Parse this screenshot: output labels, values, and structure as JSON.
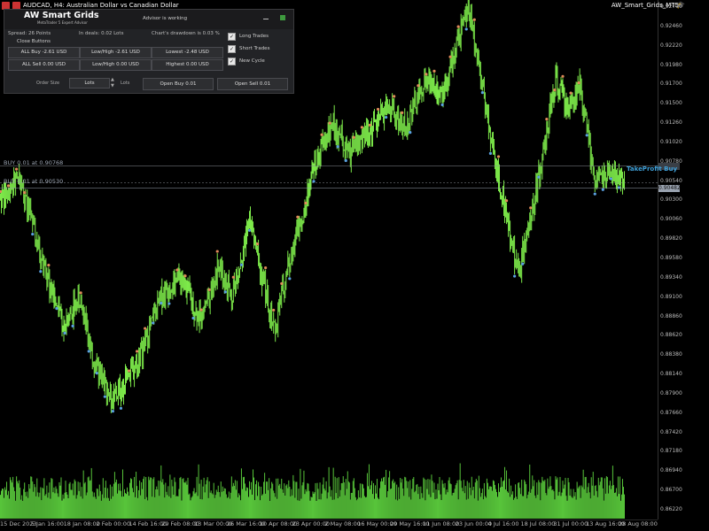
{
  "window": {
    "symbol_title": "AUDCAD, H4:  Australian Dollar vs Canadian Dollar",
    "indicator_name": "AW_Smart_Grids_MT5"
  },
  "colors": {
    "background": "#000000",
    "price_bars": "#7dea4a",
    "volume": "#57c43a",
    "buy_marker": "#5aa0e0",
    "sell_marker": "#e08a5a",
    "take_profit": "#3fa0d8"
  },
  "icons": {
    "window_icon": "chart-window-icon",
    "indicator_icon": "graduation-cap-icon"
  },
  "panel": {
    "title": "AW Smart Grids",
    "subtitle": "MetaTrader 5 Expert Advisor",
    "status": "Advisor is working",
    "stats": {
      "spread": "Spread: 26 Points",
      "in_deals": "In deals: 0.02 Lots",
      "drawdown": "Chart's drawdown is 0.03 %"
    },
    "close_group_title": "Close Buttons",
    "buttons": {
      "all_buy": "ALL Buy -2.61 USD",
      "low_high_neg": "Low/High -2.61 USD",
      "lowest": "Lowest -2.48 USD",
      "all_sell": "ALL Sell 0.00 USD",
      "low_high_zero": "Low/High 0.00 USD",
      "highest": "Highest 0.00 USD"
    },
    "checkboxes": {
      "long": "Long Trades",
      "short": "Short Trades",
      "new_cycle": "New Cycle"
    },
    "order_size_label": "Order Size",
    "lots_value": "Lots",
    "lots_label": "Lots",
    "open_buy": "Open Buy 0.01",
    "open_sell": "Open Sell 0.01"
  },
  "trade_lines": {
    "buy1": "BUY 0.01 at 0.90768",
    "buy2": "BUY 0.01 at 0.90530",
    "take_profit": "TakeProfit Buy",
    "current_price": "0.90482"
  },
  "chart_data": {
    "type": "candlestick",
    "symbol": "AUDCAD",
    "timeframe": "H4",
    "y_ticks": [
      "0.92700",
      "0.92460",
      "0.92220",
      "0.91980",
      "0.91700",
      "0.91500",
      "0.91260",
      "0.91020",
      "0.90780",
      "0.90540",
      "0.90300",
      "0.90060",
      "0.89820",
      "0.89580",
      "0.89340",
      "0.89100",
      "0.88860",
      "0.88620",
      "0.88380",
      "0.88140",
      "0.87900",
      "0.87660",
      "0.87420",
      "0.87180",
      "0.86940",
      "0.86700",
      "0.86220"
    ],
    "x_ticks": [
      "15 Dec 2023",
      "5 Jan 16:00",
      "18 Jan 08:00",
      "2 Feb 00:00",
      "14 Feb 16:00",
      "29 Feb 08:00",
      "13 Mar 00:00",
      "26 Mar 16:00",
      "10 Apr 08:00",
      "23 Apr 00:00",
      "2 May 08:00",
      "16 May 00:00",
      "29 May 16:00",
      "11 Jun 08:00",
      "23 Jun 00:00",
      "4 Jul 16:00",
      "18 Jul 08:00",
      "31 Jul 00:00",
      "13 Aug 16:00",
      "28 Aug 08:00"
    ],
    "ylim": [
      0.862,
      0.927
    ],
    "price_path": [
      {
        "t": 0,
        "p": 0.9018
      },
      {
        "t": 0.03,
        "p": 0.9048
      },
      {
        "t": 0.05,
        "p": 0.8985
      },
      {
        "t": 0.08,
        "p": 0.89
      },
      {
        "t": 0.1,
        "p": 0.8855
      },
      {
        "t": 0.13,
        "p": 0.889
      },
      {
        "t": 0.15,
        "p": 0.88
      },
      {
        "t": 0.18,
        "p": 0.8755
      },
      {
        "t": 0.21,
        "p": 0.879
      },
      {
        "t": 0.23,
        "p": 0.8825
      },
      {
        "t": 0.26,
        "p": 0.8895
      },
      {
        "t": 0.29,
        "p": 0.8915
      },
      {
        "t": 0.32,
        "p": 0.886
      },
      {
        "t": 0.35,
        "p": 0.893
      },
      {
        "t": 0.37,
        "p": 0.889
      },
      {
        "t": 0.4,
        "p": 0.899
      },
      {
        "t": 0.42,
        "p": 0.8915
      },
      {
        "t": 0.44,
        "p": 0.8845
      },
      {
        "t": 0.46,
        "p": 0.893
      },
      {
        "t": 0.48,
        "p": 0.8985
      },
      {
        "t": 0.5,
        "p": 0.905
      },
      {
        "t": 0.53,
        "p": 0.912
      },
      {
        "t": 0.56,
        "p": 0.908
      },
      {
        "t": 0.59,
        "p": 0.9105
      },
      {
        "t": 0.62,
        "p": 0.914
      },
      {
        "t": 0.65,
        "p": 0.911
      },
      {
        "t": 0.68,
        "p": 0.9175
      },
      {
        "t": 0.71,
        "p": 0.916
      },
      {
        "t": 0.73,
        "p": 0.9215
      },
      {
        "t": 0.75,
        "p": 0.9268
      },
      {
        "t": 0.77,
        "p": 0.918
      },
      {
        "t": 0.79,
        "p": 0.9085
      },
      {
        "t": 0.81,
        "p": 0.9
      },
      {
        "t": 0.83,
        "p": 0.892
      },
      {
        "t": 0.85,
        "p": 0.8995
      },
      {
        "t": 0.87,
        "p": 0.908
      },
      {
        "t": 0.89,
        "p": 0.9175
      },
      {
        "t": 0.91,
        "p": 0.9135
      },
      {
        "t": 0.93,
        "p": 0.917
      },
      {
        "t": 0.95,
        "p": 0.9048
      }
    ],
    "volume_range": [
      0.4,
      1.0
    ]
  }
}
